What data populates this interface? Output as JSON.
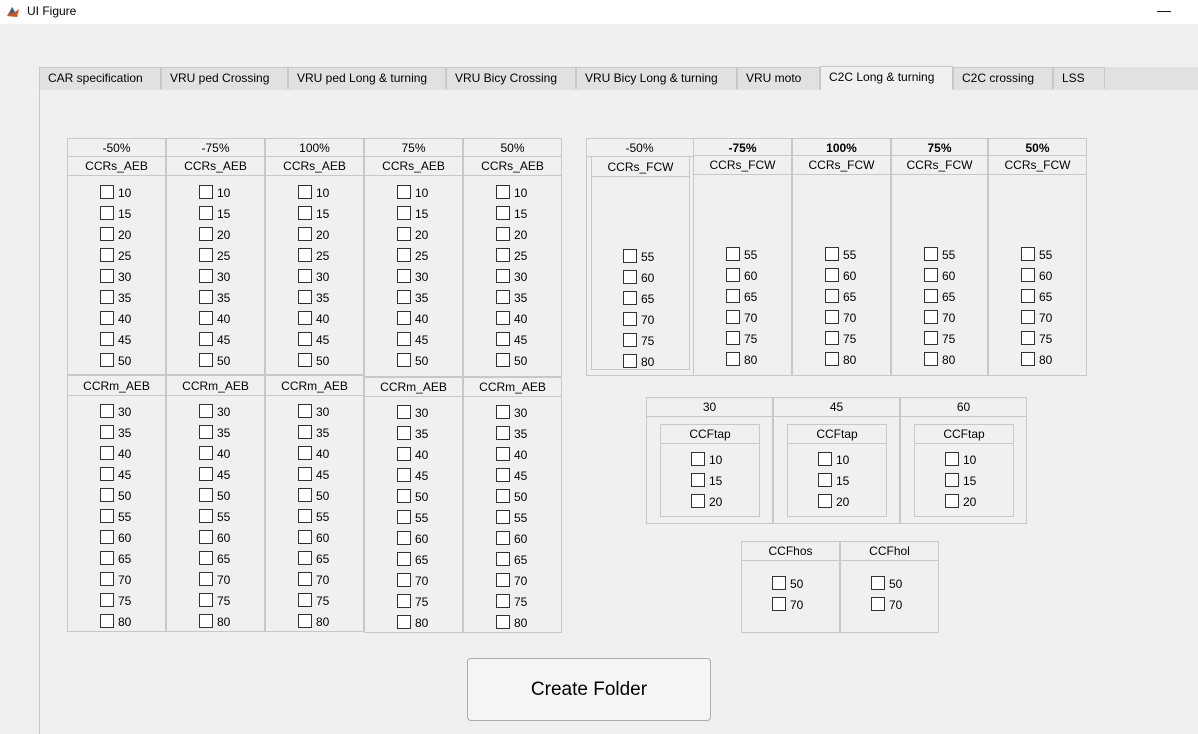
{
  "window": {
    "title": "UI Figure",
    "minimize_glyph": "—"
  },
  "tabs": [
    {
      "label": "CAR specification"
    },
    {
      "label": "VRU ped Crossing"
    },
    {
      "label": "VRU ped Long & turning"
    },
    {
      "label": "VRU Bicy Crossing"
    },
    {
      "label": "VRU Bicy Long & turning"
    },
    {
      "label": "VRU moto"
    },
    {
      "label": "C2C Long & turning",
      "active": true
    },
    {
      "label": "C2C crossing"
    },
    {
      "label": "LSS"
    }
  ],
  "aeb_columns": [
    {
      "overlap": "-50%",
      "ccrs_title": "CCRs_AEB",
      "ccrm_title": "CCRm_AEB"
    },
    {
      "overlap": "-75%",
      "ccrs_title": "CCRs_AEB",
      "ccrm_title": "CCRm_AEB"
    },
    {
      "overlap": "100%",
      "ccrs_title": "CCRs_AEB",
      "ccrm_title": "CCRm_AEB"
    },
    {
      "overlap": "75%",
      "ccrs_title": "CCRs_AEB",
      "ccrm_title": "CCRm_AEB"
    },
    {
      "overlap": "50%",
      "ccrs_title": "CCRs_AEB",
      "ccrm_title": "CCRm_AEB"
    }
  ],
  "ccrs_aeb_speeds": [
    "10",
    "15",
    "20",
    "25",
    "30",
    "35",
    "40",
    "45",
    "50"
  ],
  "ccrm_aeb_speeds": [
    "30",
    "35",
    "40",
    "45",
    "50",
    "55",
    "60",
    "65",
    "70",
    "75",
    "80"
  ],
  "fcw_columns": [
    {
      "overlap": "-50%",
      "title": "CCRs_FCW"
    },
    {
      "overlap": "-75%",
      "title": "CCRs_FCW"
    },
    {
      "overlap": "100%",
      "title": "CCRs_FCW"
    },
    {
      "overlap": "75%",
      "title": "CCRs_FCW"
    },
    {
      "overlap": "50%",
      "title": "CCRs_FCW"
    }
  ],
  "fcw_speeds": [
    "55",
    "60",
    "65",
    "70",
    "75",
    "80"
  ],
  "ccftap_columns": [
    {
      "header": "30",
      "title": "CCFtap"
    },
    {
      "header": "45",
      "title": "CCFtap"
    },
    {
      "header": "60",
      "title": "CCFtap"
    }
  ],
  "ccftap_speeds": [
    "10",
    "15",
    "20"
  ],
  "ccfho_columns": [
    {
      "title": "CCFhos"
    },
    {
      "title": "CCFhol"
    }
  ],
  "ccfho_speeds": [
    "50",
    "70"
  ],
  "create_button": {
    "label": "Create Folder"
  }
}
